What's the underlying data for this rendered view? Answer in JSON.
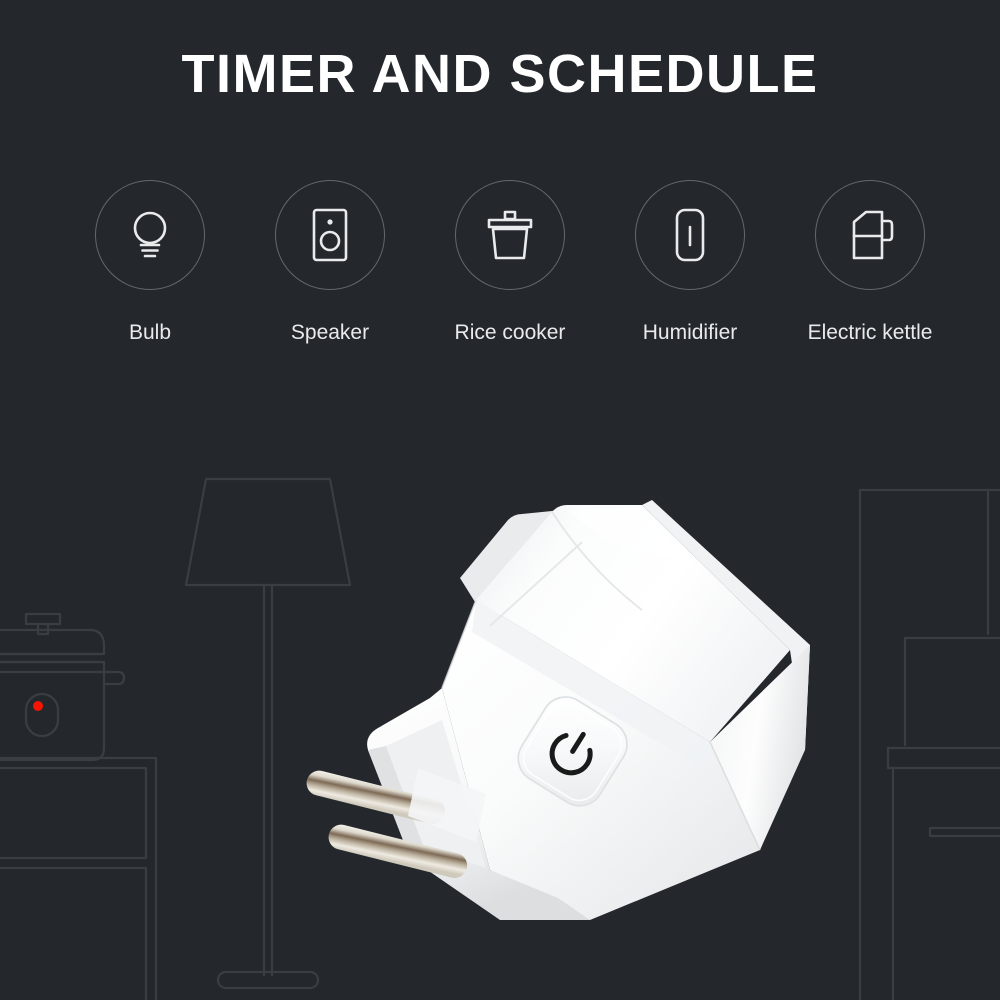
{
  "page": {
    "background_color": "#24282c",
    "title": "TIMER AND SCHEDULE"
  },
  "features": [
    {
      "id": "bulb",
      "label": "Bulb",
      "icon": "bulb-icon"
    },
    {
      "id": "speaker",
      "label": "Speaker",
      "icon": "speaker-icon"
    },
    {
      "id": "rice-cooker",
      "label": "Rice cooker",
      "icon": "rice-cooker-icon"
    },
    {
      "id": "humidifier",
      "label": "Humidifier",
      "icon": "humidifier-icon"
    },
    {
      "id": "electric-kettle",
      "label": "Electric kettle",
      "icon": "electric-kettle-icon"
    }
  ],
  "product": {
    "name": "smart-plug",
    "body_color": "#ffffff",
    "pin_color": "#d8d4cc",
    "button_icon": "power-icon"
  },
  "background_art": {
    "line_color": "#393e43",
    "led_color": "#f51500",
    "items": [
      "floor-lamp",
      "rice-cooker-outline",
      "counter-cabinet-left",
      "cabinet-right",
      "shelf-right"
    ]
  },
  "colors": {
    "background": "#24282c",
    "title_text": "#ffffff",
    "label_text": "#e8eaec",
    "circle_stroke": "#63686d",
    "icon_stroke": "#e8eaec",
    "art_line": "#393e43",
    "led_red": "#f51500"
  }
}
